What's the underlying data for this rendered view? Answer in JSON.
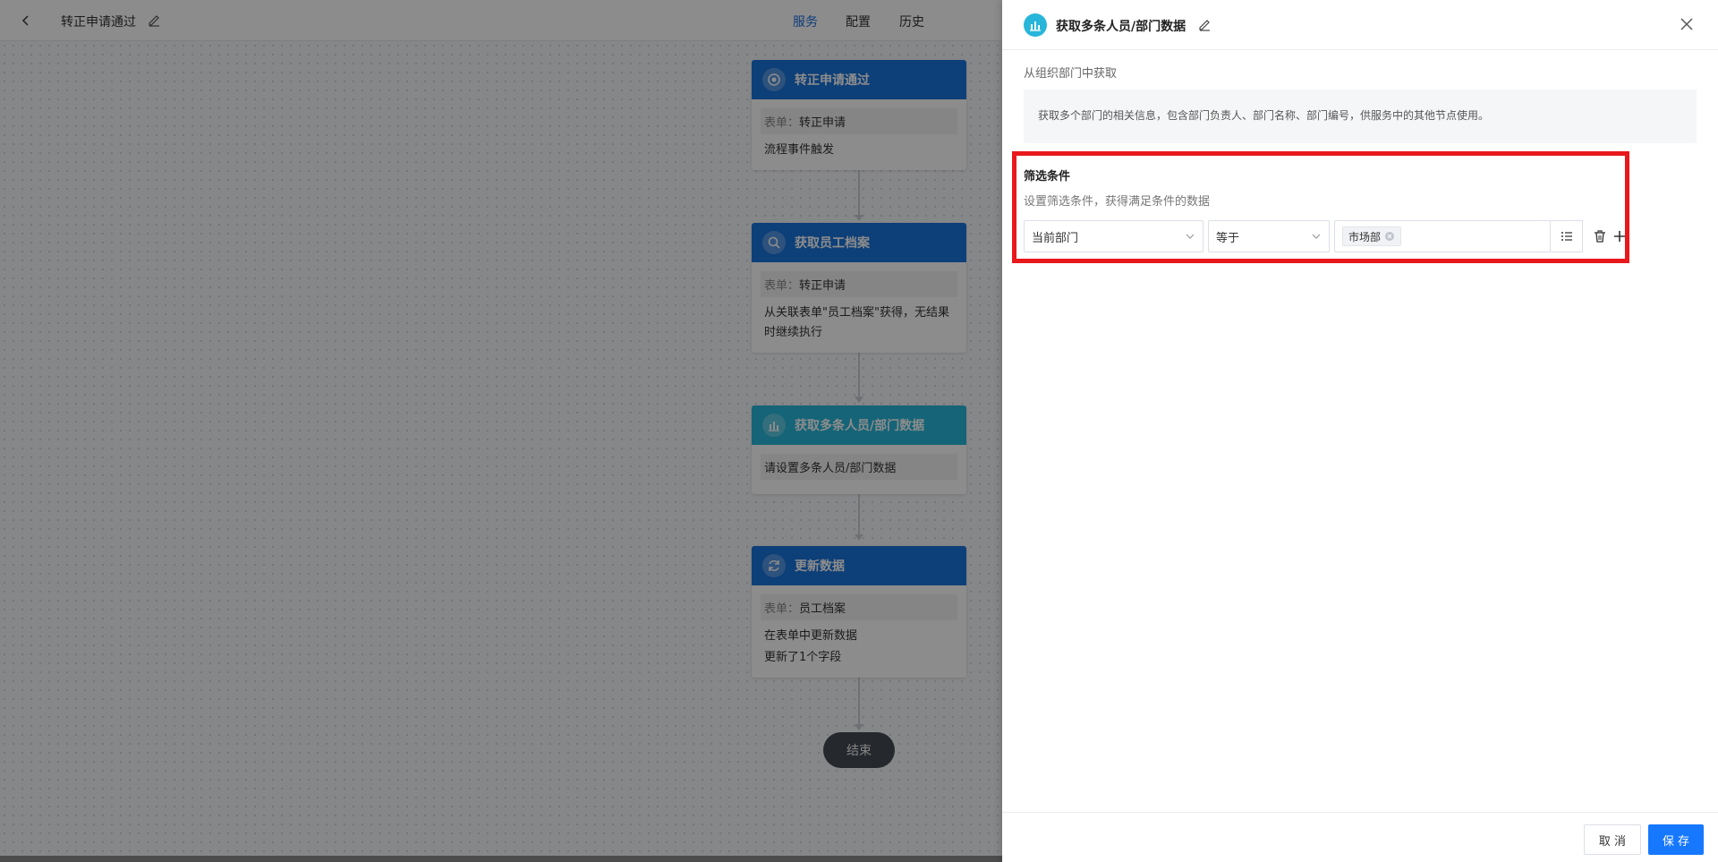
{
  "header": {
    "title": "转正申请通过",
    "nav": [
      "服务",
      "配置",
      "历史"
    ],
    "active_nav": "服务"
  },
  "nodes": [
    {
      "title": "转正申请通过",
      "icon": "target-icon",
      "field_label": "表单：",
      "field_value": "转正申请",
      "lines": [
        "流程事件触发"
      ]
    },
    {
      "title": "获取员工档案",
      "icon": "search-icon",
      "field_label": "表单：",
      "field_value": "转正申请",
      "lines": [
        "从关联表单\"员工档案\"获得，无结果",
        "时继续执行"
      ]
    },
    {
      "title": "获取多条人员/部门数据",
      "icon": "bar-chart-icon",
      "lines": [
        "请设置多条人员/部门数据"
      ]
    },
    {
      "title": "更新数据",
      "icon": "refresh-icon",
      "field_label": "表单：",
      "field_value": "员工档案",
      "lines": [
        "在表单中更新数据",
        "更新了1个字段"
      ]
    }
  ],
  "end_label": "结束",
  "drawer": {
    "title": "获取多条人员/部门数据",
    "source_label": "从组织部门中获取",
    "description": "获取多个部门的相关信息，包含部门负责人、部门名称、部门编号，供服务中的其他节点使用。",
    "filter": {
      "title": "筛选条件",
      "description": "设置筛选条件，获得满足条件的数据",
      "field": "当前部门",
      "operator": "等于",
      "value_tag": "市场部"
    },
    "cancel_label": "取 消",
    "save_label": "保 存"
  },
  "colors": {
    "primary": "#1677ff",
    "node_blue": "#1873da",
    "node_cyan": "#27b6d9",
    "highlight": "#e8181c"
  }
}
